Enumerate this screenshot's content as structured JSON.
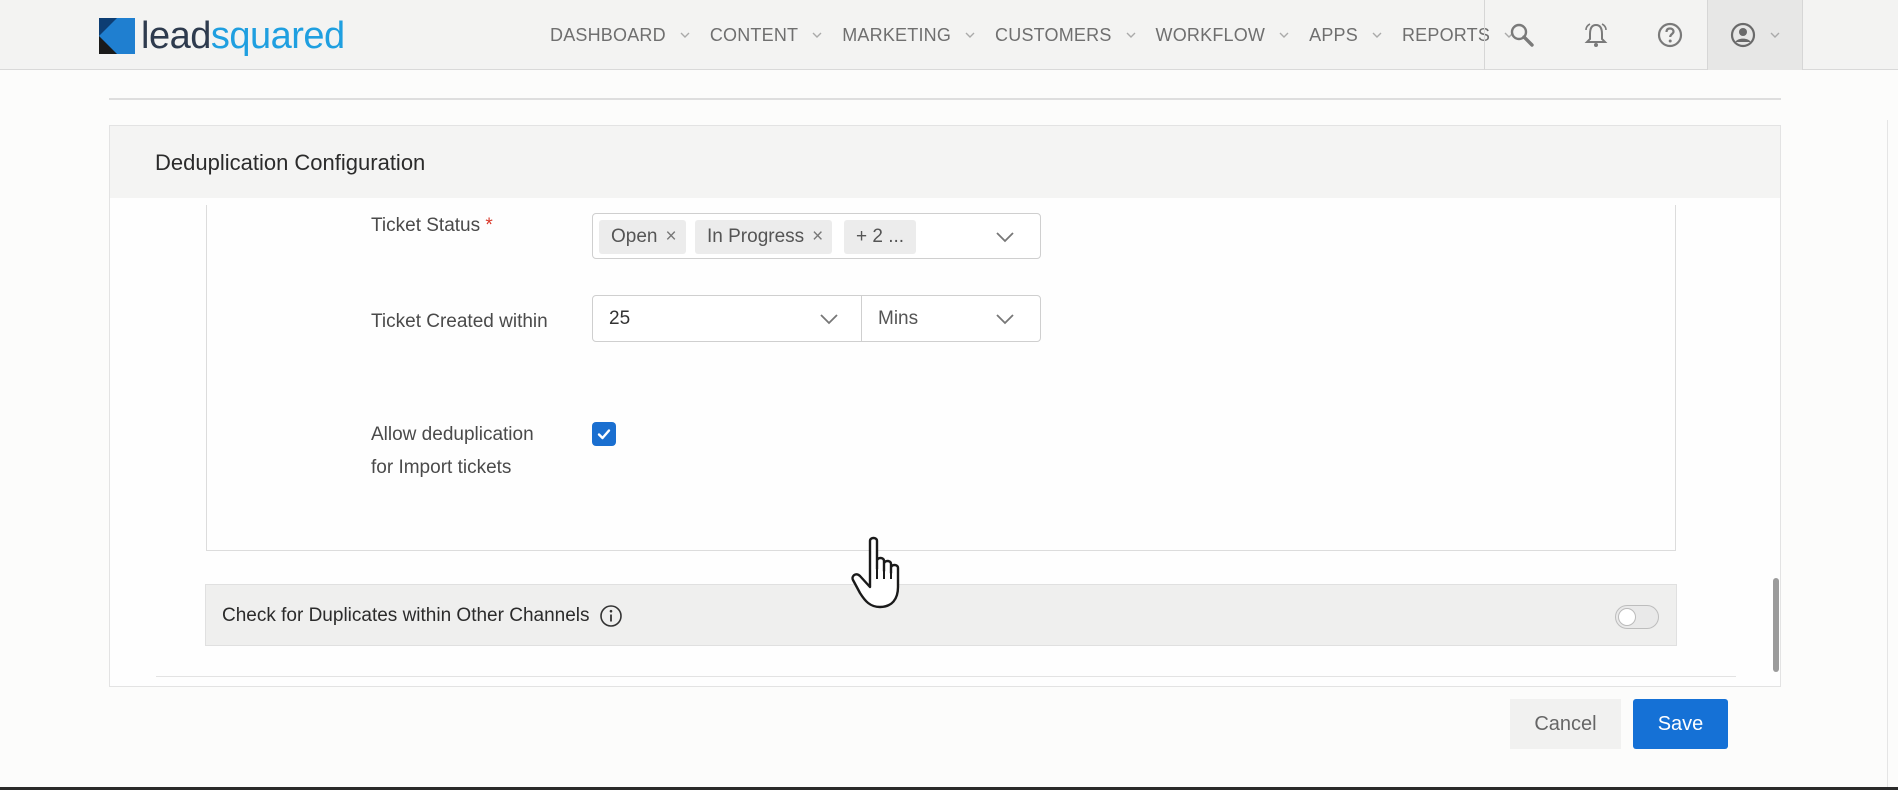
{
  "brand": {
    "part1": "lead",
    "part2": "squared"
  },
  "nav": {
    "items": [
      {
        "label": "DASHBOARD"
      },
      {
        "label": "CONTENT"
      },
      {
        "label": "MARKETING"
      },
      {
        "label": "CUSTOMERS"
      },
      {
        "label": "WORKFLOW"
      },
      {
        "label": "APPS"
      },
      {
        "label": "REPORTS"
      }
    ],
    "tools": [
      "search-icon",
      "bell-icon",
      "help-icon",
      "user-icon"
    ]
  },
  "panel": {
    "title": "Deduplication Configuration",
    "ticket_status": {
      "label": "Ticket Status",
      "required_mark": "*",
      "chips": [
        "Open",
        "In Progress",
        "+ 2 ..."
      ],
      "chip_remove": "×"
    },
    "ticket_created": {
      "label": "Ticket Created within",
      "value": "25",
      "unit": "Mins"
    },
    "allow_import": {
      "label_line1": "Allow deduplication",
      "label_line2": "for Import tickets",
      "checked": true
    },
    "other_channels": {
      "label": "Check for Duplicates within Other Channels",
      "enabled": false
    }
  },
  "actions": {
    "cancel": "Cancel",
    "save": "Save"
  },
  "colors": {
    "primary": "#1571d6",
    "brand_blue": "#1f9fe0",
    "required": "#d9392b"
  }
}
